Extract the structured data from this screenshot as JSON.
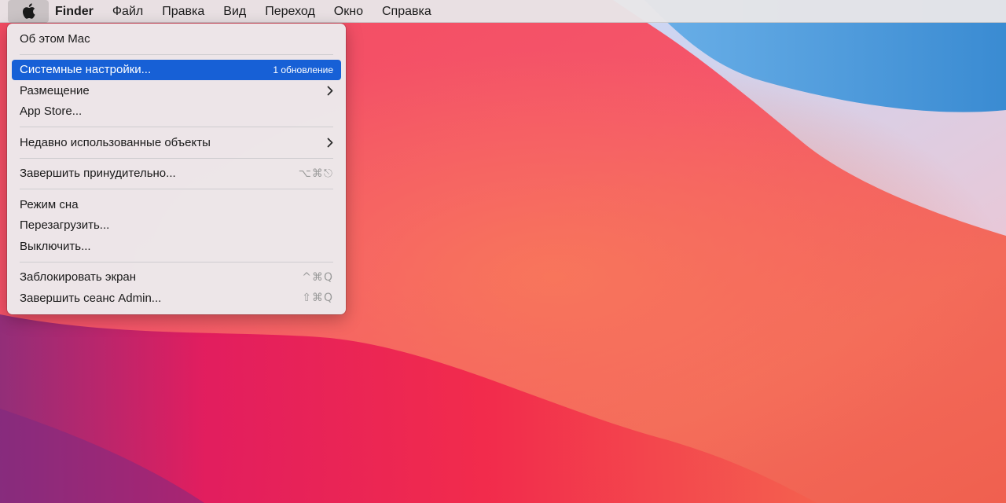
{
  "menubar": {
    "apple_icon": "apple-logo-icon",
    "app_name": "Finder",
    "items": [
      "Файл",
      "Правка",
      "Вид",
      "Переход",
      "Окно",
      "Справка"
    ]
  },
  "dropdown": {
    "about": "Об этом Mac",
    "system_prefs": "Системные настройки...",
    "system_prefs_badge": "1 обновление",
    "location": "Размещение",
    "app_store": "App Store...",
    "recent_items": "Недавно использованные объекты",
    "force_quit": "Завершить принудительно...",
    "force_quit_shortcut": "⌥⌘⎋",
    "sleep": "Режим сна",
    "restart": "Перезагрузить...",
    "shutdown": "Выключить...",
    "lock_screen": "Заблокировать экран",
    "lock_screen_shortcut": "^⌘Q",
    "log_out": "Завершить сеанс Admin...",
    "log_out_shortcut": "⇧⌘Q"
  },
  "colors": {
    "highlight": "#1760d6",
    "menubar_bg": "#e8e6e8",
    "menu_bg": "#eceaec",
    "wallpaper_red": "#f0395a",
    "wallpaper_blue": "#3f8fd6"
  }
}
